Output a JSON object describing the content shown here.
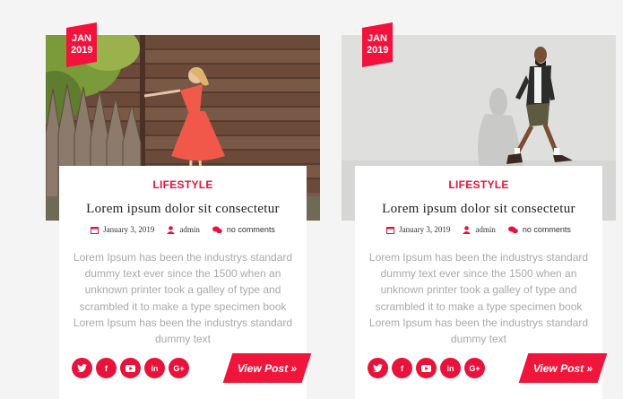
{
  "posts": [
    {
      "date": {
        "month": "JAN",
        "year": "2019"
      },
      "category": "LIFESTYLE",
      "title": "Lorem ipsum dolor sit consectetur",
      "meta": {
        "date": "January 3, 2019",
        "author": "admin",
        "comments": "no comments"
      },
      "excerpt": "Lorem Ipsum has been the industrys standard dummy text ever since the 1500 when an unknown printer took a galley of type and scrambled it to make a type specimen book Lorem Ipsum has been the industrys standard dummy text",
      "socials": [
        "twitter-icon",
        "facebook-icon",
        "youtube-icon",
        "linkedin-icon",
        "google-plus-icon"
      ],
      "button": "View Post »"
    },
    {
      "date": {
        "month": "JAN",
        "year": "2019"
      },
      "category": "LIFESTYLE",
      "title": "Lorem ipsum dolor sit consectetur",
      "meta": {
        "date": "January 3, 2019",
        "author": "admin",
        "comments": "no comments"
      },
      "excerpt": "Lorem Ipsum has been the industrys standard dummy text ever since the 1500 when an unknown printer took a galley of type and scrambled it to make a type specimen book Lorem Ipsum has been the industrys standard dummy text",
      "socials": [
        "twitter-icon",
        "facebook-icon",
        "youtube-icon",
        "linkedin-icon",
        "google-plus-icon"
      ],
      "button": "View Post »"
    }
  ],
  "colors": {
    "accent": "#e8123b",
    "background": "#f4f4f4",
    "card": "#ffffff",
    "excerpt": "#a9a9a9"
  }
}
